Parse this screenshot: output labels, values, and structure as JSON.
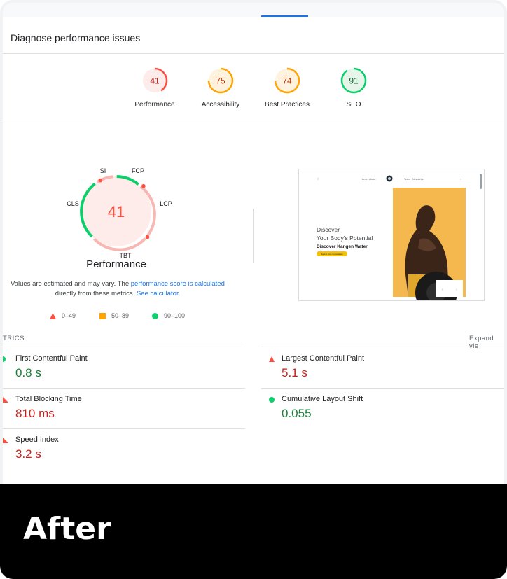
{
  "section_title": "Diagnose performance issues",
  "colors": {
    "fail": "#ff4e42",
    "average": "#ffa400",
    "pass": "#0cce6b",
    "link": "#1a73e8"
  },
  "categories": [
    {
      "score": "41",
      "label": "Performance",
      "value": 0.41,
      "rating": "fail"
    },
    {
      "score": "75",
      "label": "Accessibility",
      "value": 0.75,
      "rating": "average"
    },
    {
      "score": "74",
      "label": "Best Practices",
      "value": 0.74,
      "rating": "average"
    },
    {
      "score": "91",
      "label": "SEO",
      "value": 0.91,
      "rating": "pass"
    }
  ],
  "performance": {
    "score": "41",
    "title": "Performance",
    "segments": [
      "SI",
      "FCP",
      "LCP",
      "TBT",
      "CLS"
    ]
  },
  "note": {
    "text1": "Values are estimated and may vary. The",
    "link1": "performance score is calculated",
    "text2": "directly from these metrics.",
    "link2": "See calculator."
  },
  "legend": [
    {
      "range": "0–49",
      "shape": "triangle"
    },
    {
      "range": "50–89",
      "shape": "square"
    },
    {
      "range": "90–100",
      "shape": "circle"
    }
  ],
  "metrics_header": "TRICS",
  "expand_label": "Expand vie",
  "metrics": [
    {
      "name": "First Contentful Paint",
      "value": "0.8 s",
      "rating": "pass"
    },
    {
      "name": "Largest Contentful Paint",
      "value": "5.1 s",
      "rating": "fail"
    },
    {
      "name": "Total Blocking Time",
      "value": "810 ms",
      "rating": "fail"
    },
    {
      "name": "Cumulative Layout Shift",
      "value": "0.055",
      "rating": "pass"
    },
    {
      "name": "Speed Index",
      "value": "3.2 s",
      "rating": "fail"
    }
  ],
  "screenshot": {
    "nav1": "Home",
    "nav2": "About",
    "nav3": "Team",
    "nav4": "Newsletter",
    "line1": "Discover",
    "line2": "Your Body's Potential",
    "line3": "Discover Kangen Water",
    "cta": "Book A Free Consultation"
  },
  "banner_text": "After"
}
